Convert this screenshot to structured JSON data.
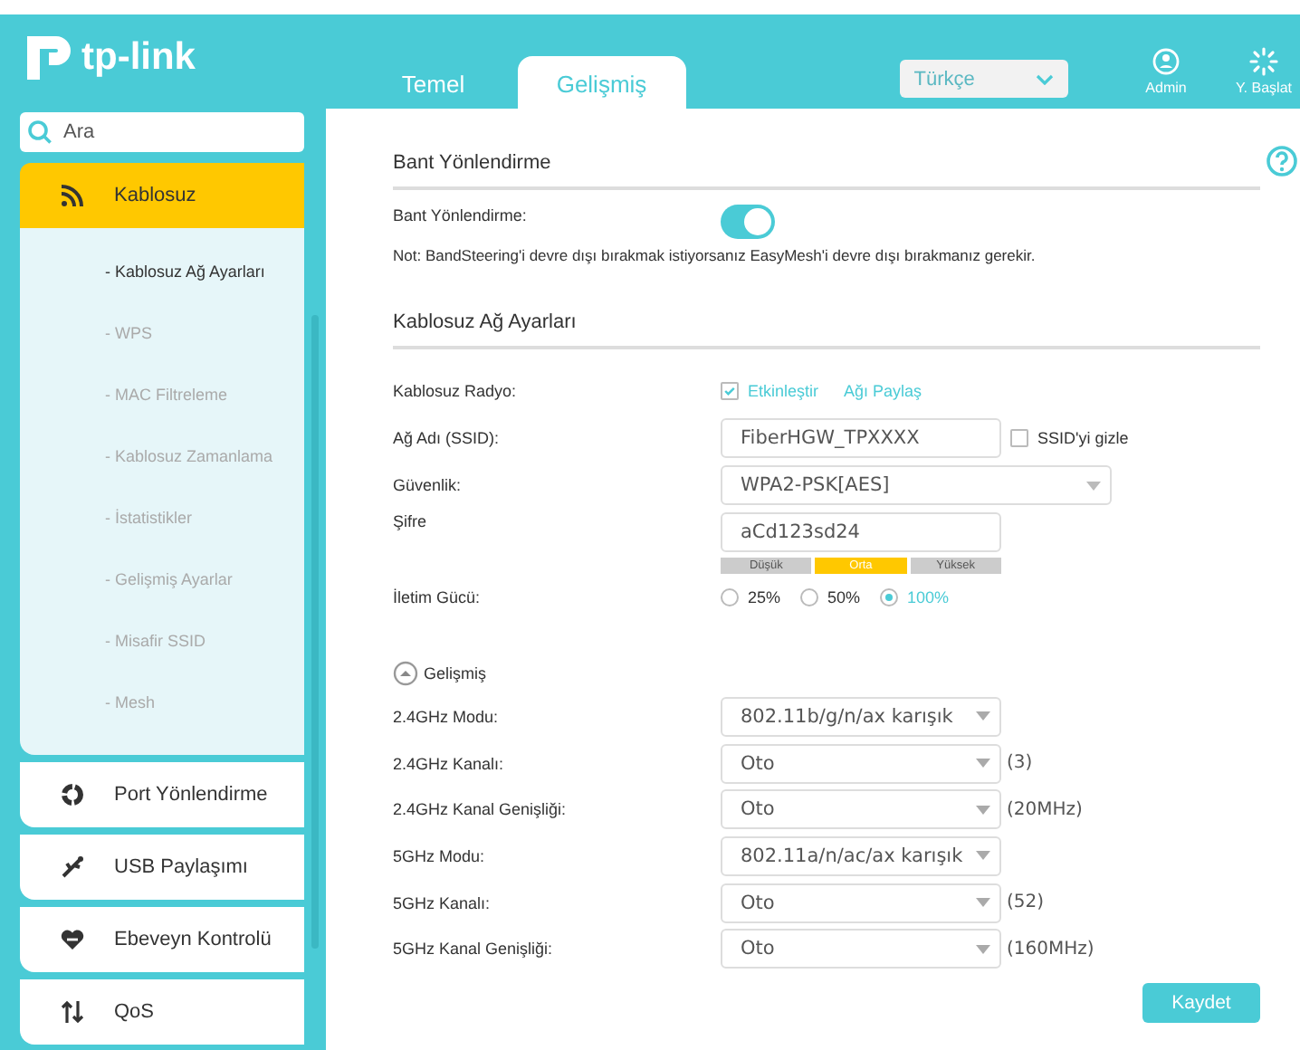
{
  "header": {
    "logo": "tp-link",
    "tabs": [
      {
        "label": "Temel",
        "selected": false
      },
      {
        "label": "Gelişmiş",
        "selected": true
      }
    ],
    "language": "Türkçe",
    "actions": [
      {
        "label": "Admin",
        "kind": "admin"
      },
      {
        "label": "Y. Başlat",
        "kind": "reboot"
      }
    ]
  },
  "sidebar": {
    "search_placeholder": "Ara",
    "items": [
      {
        "label": "Kablosuz",
        "kind": "wifi",
        "selected": true,
        "expanded": true,
        "children": [
          {
            "label": "- Kablosuz Ağ Ayarları",
            "selected": true
          },
          {
            "label": "- WPS",
            "selected": false
          },
          {
            "label": "- MAC Filtreleme",
            "selected": false
          },
          {
            "label": "- Kablosuz Zamanlama",
            "selected": false
          },
          {
            "label": "- İstatistikler",
            "selected": false
          },
          {
            "label": "- Gelişmiş Ayarlar",
            "selected": false
          },
          {
            "label": "- Misafir SSID",
            "selected": false
          },
          {
            "label": "- Mesh",
            "selected": false
          }
        ]
      },
      {
        "label": "Port Yönlendirme",
        "kind": "ring",
        "selected": false,
        "expanded": false
      },
      {
        "label": "USB Paylaşımı",
        "kind": "usb",
        "selected": false,
        "expanded": false
      },
      {
        "label": "Ebeveyn Kontrolü",
        "kind": "heart",
        "selected": false,
        "expanded": false
      },
      {
        "label": "QoS",
        "kind": "arrows",
        "selected": false,
        "expanded": false
      }
    ]
  },
  "band_steering": {
    "title": "Bant Yönlendirme",
    "label": "Bant Yönlendirme:",
    "on": true,
    "note": "Not: BandSteering'i devre dışı bırakmak istiyorsanız EasyMesh'i devre dışı bırakmanız gerekir."
  },
  "wireless": {
    "title": "Kablosuz Ağ Ayarları",
    "rows": [
      {
        "kind": "enable",
        "label": "Kablosuz Radyo:",
        "checkbox": {
          "label": "Etkinleştir",
          "checked": true
        },
        "link": "Ağı Paylaş"
      },
      {
        "kind": "text",
        "label": "Ağ Adı (SSID):",
        "value": "FiberHGW_TPXXXX",
        "checkbox": {
          "label": "SSID'yi gizle",
          "checked": false
        }
      },
      {
        "kind": "dropdown",
        "label": "Güvenlik:",
        "value": "WPA2-PSK[AES]"
      },
      {
        "kind": "password",
        "label": "Şifre",
        "value": "aCd123sd24",
        "strength": [
          {
            "label": "Düşük",
            "selected": false
          },
          {
            "label": "Orta",
            "selected": true
          },
          {
            "label": "Yüksek",
            "selected": false
          }
        ]
      },
      {
        "kind": "radio",
        "label": "İletim Gücü:",
        "options": [
          {
            "label": "25%",
            "selected": false
          },
          {
            "label": "50%",
            "selected": false
          },
          {
            "label": "100%",
            "selected": true
          }
        ]
      }
    ]
  },
  "advanced": {
    "label": "Gelişmiş",
    "expanded": true,
    "rows": [
      {
        "label": "2.4GHz Modu:",
        "value": "802.11b/g/n/ax karışık"
      },
      {
        "label": "2.4GHz Kanalı:",
        "value": "Oto",
        "note": "(3)"
      },
      {
        "label": "2.4GHz Kanal Genişliği:",
        "value": "Oto",
        "note": "(20MHz)"
      },
      {
        "label": "5GHz Modu:",
        "value": "802.11a/n/ac/ax karışık"
      },
      {
        "label": "5GHz Kanalı:",
        "value": "Oto",
        "note": "(52)"
      },
      {
        "label": "5GHz Kanal Genişliği:",
        "value": "Oto",
        "note": "(160MHz)"
      }
    ]
  },
  "save": "Kaydet"
}
